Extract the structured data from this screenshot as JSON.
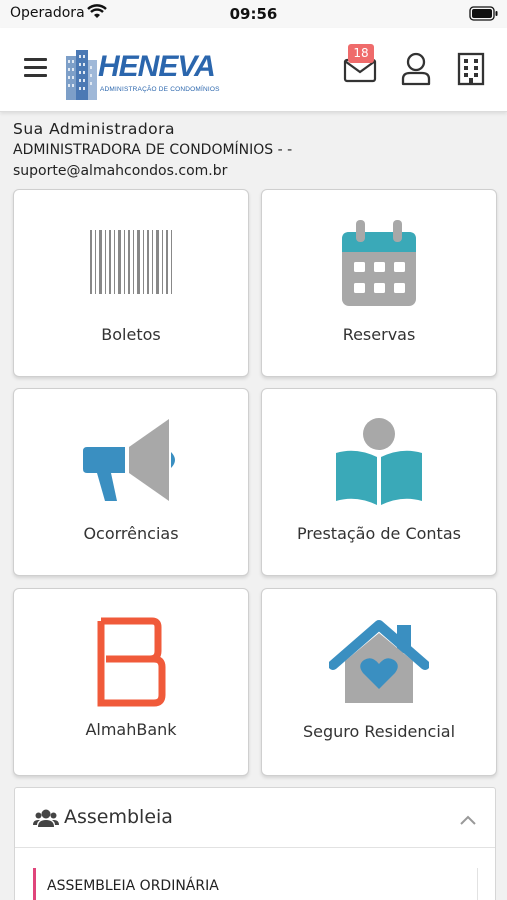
{
  "status_bar": {
    "carrier": "Operadora",
    "time": "09:56"
  },
  "header": {
    "logo_text": "HENEVA",
    "logo_subtitle": "ADMINISTRAÇÃO DE CONDOMÍNIOS",
    "mail_count": "18",
    "icons": [
      "menu-icon",
      "mail-icon",
      "user-icon",
      "building-icon"
    ]
  },
  "admin": {
    "title": "Sua Administradora",
    "name": "ADMINISTRADORA DE CONDOMÍNIOS - -",
    "email": "suporte@almahcondos.com.br"
  },
  "tiles": [
    {
      "label": "Boletos",
      "icon": "barcode-icon"
    },
    {
      "label": "Reservas",
      "icon": "calendar-icon"
    },
    {
      "label": "Ocorrências",
      "icon": "megaphone-icon"
    },
    {
      "label": "Prestação de Contas",
      "icon": "reading-person-icon"
    },
    {
      "label": "AlmahBank",
      "icon": "almahbank-logo-icon"
    },
    {
      "label": "Seguro Residencial",
      "icon": "house-heart-icon"
    }
  ],
  "colors": {
    "brand_blue": "#2b66ad",
    "icon_blue": "#3a8fc1",
    "icon_teal": "#3aa9b8",
    "icon_gray": "#a8a8a8",
    "almahbank_orange": "#f05a3a",
    "badge_red": "#ef6b6b",
    "accent_pink": "#e0457b"
  },
  "assembleia": {
    "title": "Assembleia",
    "items": [
      "ASSEMBLEIA ORDINÁRIA"
    ]
  }
}
